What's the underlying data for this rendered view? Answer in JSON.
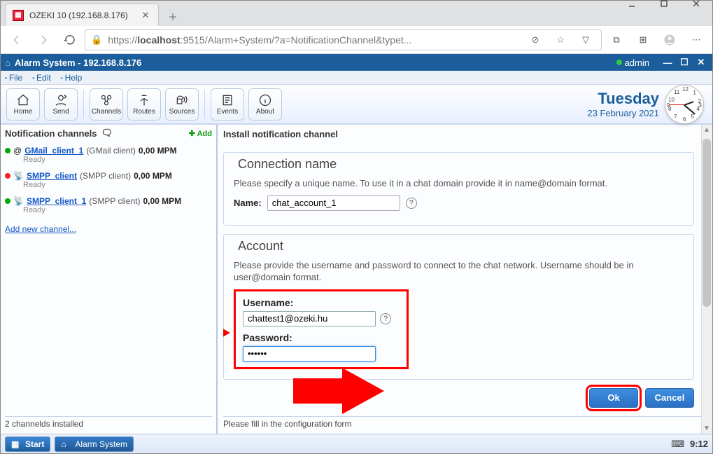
{
  "window": {
    "title": "OZEKI 10 (192.168.8.176)"
  },
  "url": {
    "prefix": "https://",
    "host": "localhost",
    "rest": ":9515/Alarm+System/?a=NotificationChannel&typet..."
  },
  "app": {
    "title": "Alarm System - 192.168.8.176",
    "user": "admin"
  },
  "menu": {
    "file": "File",
    "edit": "Edit",
    "help": "Help"
  },
  "toolbar": {
    "home": "Home",
    "send": "Send",
    "channels": "Channels",
    "routes": "Routes",
    "sources": "Sources",
    "events": "Events",
    "about": "About"
  },
  "date": {
    "dow": "Tuesday",
    "date": "23 February 2021"
  },
  "left": {
    "header": "Notification channels",
    "add": "Add",
    "items": [
      {
        "color": "green",
        "link": "GMail_client_1",
        "type": "GMail client",
        "mpm": "0,00 MPM",
        "status": "Ready",
        "icon": "@"
      },
      {
        "color": "red",
        "link": "SMPP_client",
        "type": "SMPP client",
        "mpm": "0,00 MPM",
        "status": "Ready",
        "icon": "antenna"
      },
      {
        "color": "green",
        "link": "SMPP_client_1",
        "type": "SMPP client",
        "mpm": "0,00 MPM",
        "status": "Ready",
        "icon": "antenna"
      }
    ],
    "addnew": "Add new channel...",
    "footer": "2 channelds installed"
  },
  "right": {
    "title": "Install notification channel",
    "conn": {
      "legend": "Connection name",
      "help": "Please specify a unique name. To use it in a chat domain provide it in name@domain format.",
      "name_label": "Name:",
      "name_value": "chat_account_1"
    },
    "acct": {
      "legend": "Account",
      "help": "Please provide the username and password to connect to the chat network. Username should be in user@domain format.",
      "user_label": "Username:",
      "user_value": "chattest1@ozeki.hu",
      "pass_label": "Password:",
      "pass_value": "••••••"
    },
    "ok": "Ok",
    "cancel": "Cancel",
    "footer": "Please fill in the configuration form"
  },
  "taskbar": {
    "start": "Start",
    "task1": "Alarm System",
    "time": "9:12"
  }
}
